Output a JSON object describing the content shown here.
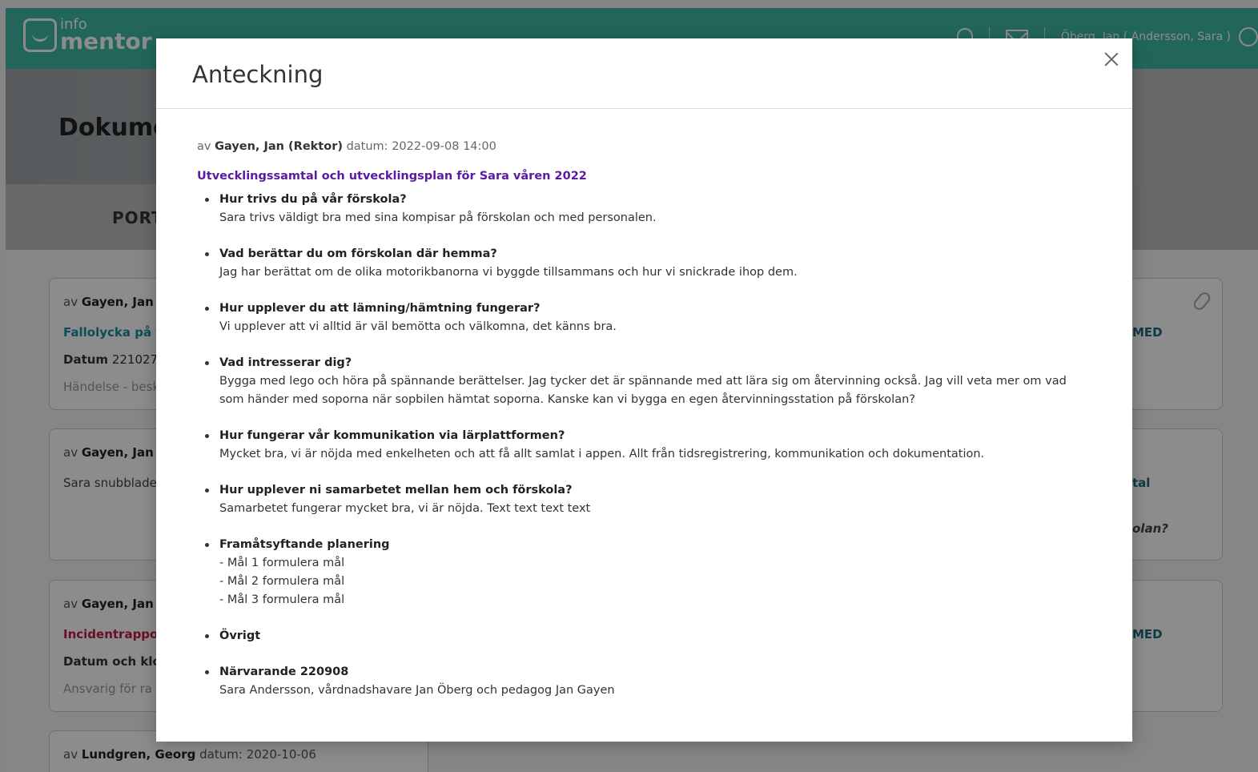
{
  "app": {
    "logo_info": "info",
    "logo_mentor": "mentor",
    "user_label": "Öberg, Jan ( Andersson, Sara )"
  },
  "background": {
    "page_title": "Dokume",
    "subnav_label": "PORT",
    "cards": [
      {
        "author_prefix": "av",
        "author": "Gayen, Jan (R",
        "link": "Fallolycka på fö",
        "datum_label": "Datum",
        "datum_value": "221027,",
        "faded": "Händelse - besk",
        "right_text": "MED"
      },
      {
        "author_prefix": "av",
        "author": "Gayen, Jan (R",
        "text": "Sara snubblade",
        "right_text": "tal",
        "right_italic": "olan?"
      },
      {
        "author_prefix": "av",
        "author": "Gayen, Jan (R",
        "link": "Incidentrappor",
        "datum_label": "Datum och klo",
        "faded": "Ansvarig för ra",
        "right_text": "MED"
      },
      {
        "author_prefix": "av",
        "author": "Lundgren, Georg",
        "datum_label": "datum:",
        "datum_value": "2020-10-06"
      }
    ]
  },
  "modal": {
    "title": "Anteckning",
    "author_prefix": "av",
    "author": "Gayen, Jan (Rektor)",
    "date_label": "datum:",
    "date_value": "2022-09-08 14:00",
    "doc_title": "Utvecklingssamtal och utvecklingsplan för Sara våren 2022",
    "items": [
      {
        "question": "Hur trivs du på vår förskola?",
        "answer": "Sara trivs väldigt bra med sina kompisar på förskolan och med personalen."
      },
      {
        "question": "Vad berättar du om förskolan där hemma?",
        "answer": "Jag har berättat om de olika motorikbanorna vi byggde tillsammans och hur vi snickrade ihop dem."
      },
      {
        "question": "Hur upplever du att lämning/hämtning fungerar?",
        "answer": "Vi upplever att vi alltid är väl bemötta och välkomna, det känns bra."
      },
      {
        "question": "Vad intresserar dig?",
        "answer": "Bygga med lego och höra på spännande berättelser. Jag tycker det är spännande med att lära sig om återvinning också. Jag vill veta mer om vad som händer med soporna när sopbilen hämtat soporna. Kanske kan vi bygga en egen återvinningsstation på förskolan?"
      },
      {
        "question": "Hur fungerar vår kommunikation via lärplattformen?",
        "answer": "Mycket bra, vi är nöjda med enkelheten och att få allt samlat i appen. Allt från tidsregistrering, kommunikation och dokumentation."
      },
      {
        "question": "Hur upplever ni samarbetet mellan hem och förskola?",
        "answer": "Samarbetet fungerar mycket bra, vi är nöjda. Text text text text"
      },
      {
        "question": "Framåtsyftande planering",
        "answer_lines": [
          "- Mål 1 formulera mål",
          "- Mål 2 formulera mål",
          "- Mål 3 formulera mål"
        ]
      },
      {
        "question": "Övrigt"
      },
      {
        "question": "Närvarande 220908",
        "answer": "Sara Andersson, vårdnadshavare Jan Öberg och pedagog Jan Gayen"
      }
    ]
  }
}
